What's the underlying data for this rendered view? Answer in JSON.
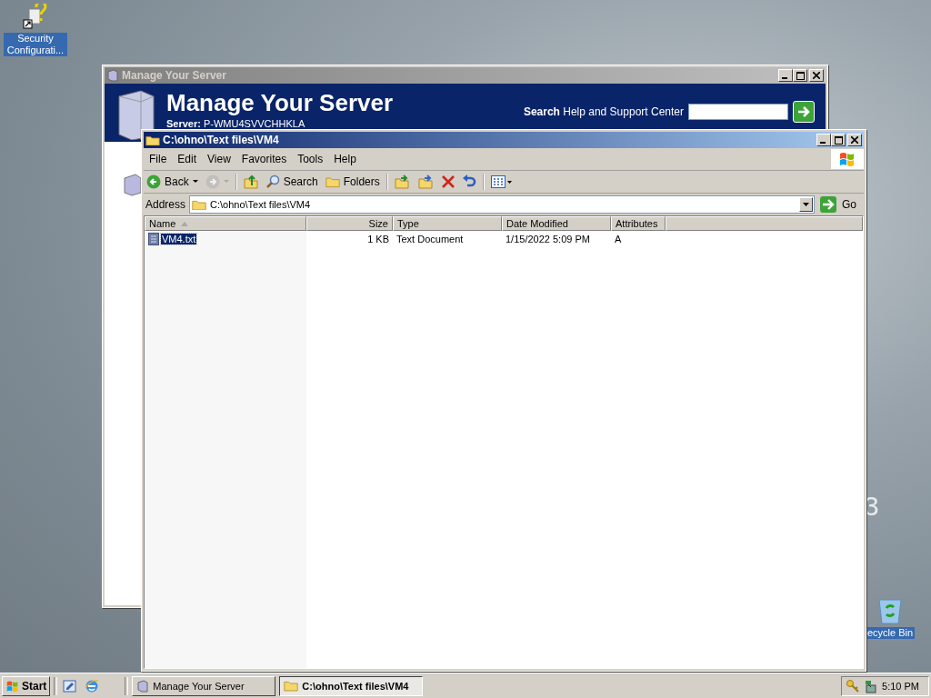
{
  "desktop": {
    "icons": [
      {
        "kind": "security",
        "label": "Security Configurati..."
      },
      {
        "kind": "recycle",
        "label": "ecycle Bin"
      }
    ],
    "wallpaper_text": "3"
  },
  "manage_server": {
    "title": "Manage Your Server",
    "active": false,
    "heading": "Manage Your Server",
    "server_line": "**Server:** P-WMU4SVVCHHKLA",
    "search_label": "**Search** Help and Support Center"
  },
  "explorer": {
    "title": "C:\\ohno\\Text files\\VM4",
    "active": true,
    "menu": [
      "File",
      "Edit",
      "View",
      "Favorites",
      "Tools",
      "Help"
    ],
    "toolbar": [
      {
        "kind": "back",
        "label": "Back",
        "disabled": false
      },
      {
        "kind": "forward",
        "disabled": true
      },
      {
        "kind": "up",
        "disabled": false
      },
      {
        "kind": "search",
        "label": "Search",
        "disabled": false
      },
      {
        "kind": "folders",
        "label": "Folders",
        "disabled": false
      },
      {
        "kind": "move",
        "disabled": false
      },
      {
        "kind": "copy",
        "disabled": false
      },
      {
        "kind": "delete",
        "disabled": false
      },
      {
        "kind": "undo",
        "disabled": false
      },
      {
        "kind": "views",
        "disabled": false
      }
    ],
    "address_label": "Address",
    "address": "C:\\ohno\\Text files\\VM4",
    "go_label": "Go",
    "columns": [
      {
        "label": "Name",
        "sorted": true
      },
      {
        "label": "Size",
        "sorted": false
      },
      {
        "label": "Type",
        "sorted": false
      },
      {
        "label": "Date Modified",
        "sorted": false
      },
      {
        "label": "Attributes",
        "sorted": false
      }
    ],
    "rows": [
      {
        "name": "VM4.txt",
        "size": "1 KB",
        "type": "Text Document",
        "date": "1/15/2022 5:09 PM",
        "attributes": "A",
        "selected": true
      }
    ]
  },
  "taskbar": {
    "start": "Start",
    "tasks": [
      {
        "kind": "server",
        "label": "Manage Your Server",
        "selected": false
      },
      {
        "kind": "folder",
        "label": "C:\\ohno\\Text files\\VM4",
        "selected": true
      }
    ],
    "clock": "5:10 PM"
  }
}
